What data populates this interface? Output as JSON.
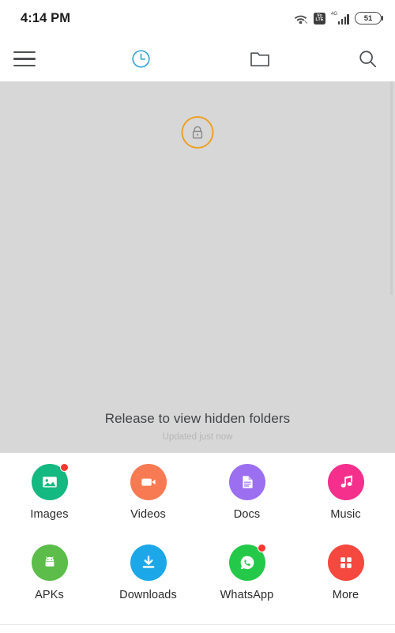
{
  "statusbar": {
    "time": "4:14 PM",
    "wifi_icon": "wifi-icon",
    "volte_line1": "Vo",
    "volte_line2": "LTE",
    "network_type": "4G",
    "signal_icon": "signal-bars-icon",
    "battery_level": "51"
  },
  "toolbar": {
    "menu_icon": "hamburger-menu-icon",
    "recent_icon": "clock-recent-icon",
    "folder_icon": "folder-icon",
    "search_icon": "search-icon",
    "accent_color": "#39a9d4"
  },
  "pull_refresh": {
    "lock_icon": "padlock-icon",
    "ring_color": "#eda121",
    "message": "Release to view hidden folders",
    "updated_text": "Updated just now",
    "background_color": "#d7d7d7"
  },
  "shortcuts": {
    "rows": [
      [
        {
          "label": "Images",
          "icon": "image-icon",
          "color": "#14b881",
          "badge": true
        },
        {
          "label": "Videos",
          "icon": "video-icon",
          "color": "#f77a52",
          "badge": false
        },
        {
          "label": "Docs",
          "icon": "document-icon",
          "color": "#9b6ff0",
          "badge": false
        },
        {
          "label": "Music",
          "icon": "music-note-icon",
          "color": "#f5308c",
          "badge": false
        }
      ],
      [
        {
          "label": "APKs",
          "icon": "android-icon",
          "color": "#5cbd4a",
          "badge": false
        },
        {
          "label": "Downloads",
          "icon": "download-icon",
          "color": "#1ca7e8",
          "badge": false
        },
        {
          "label": "WhatsApp",
          "icon": "whatsapp-icon",
          "color": "#25c94a",
          "badge": true
        },
        {
          "label": "More",
          "icon": "grid-more-icon",
          "color": "#f5483f",
          "badge": false
        }
      ]
    ]
  }
}
